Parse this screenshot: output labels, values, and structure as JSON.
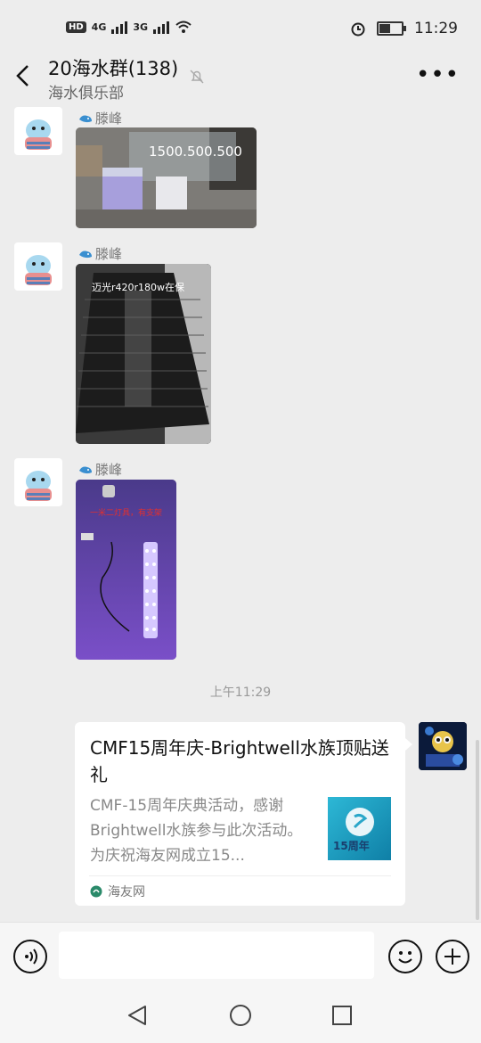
{
  "status_bar": {
    "network_badge": "HD",
    "sim1_label": "4G",
    "sim2_label": "3G",
    "time": "11:29",
    "battery_level": 0.55
  },
  "header": {
    "title": "20海水群(138)",
    "subtitle": "海水俱乐部",
    "more_label": "•••"
  },
  "messages": [
    {
      "sender": "滕峰",
      "overlay_text": "1500.500.500"
    },
    {
      "sender": "滕峰",
      "overlay_text": "迈光r420r180w在保"
    },
    {
      "sender": "滕峰",
      "overlay_text": "一米二灯具，有支架"
    }
  ],
  "timestamp": "上午11:29",
  "link_card": {
    "title": "CMF15周年庆-Brightwell水族顶贴送礼",
    "description": "CMF-15周年庆典活动，感谢Brightwell水族参与此次活动。为庆祝海友网成立15...",
    "thumb_text": "15周年",
    "source": "海友网"
  },
  "input_bar": {
    "placeholder": ""
  },
  "colors": {
    "background": "#ededed",
    "accent_red": "#e03030"
  }
}
